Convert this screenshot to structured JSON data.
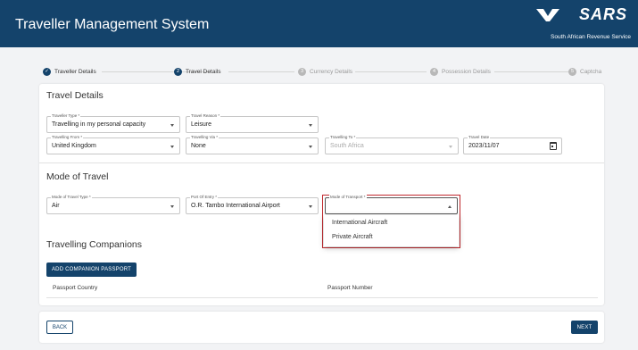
{
  "header": {
    "title": "Traveller Management System",
    "brand_logo": "SARS",
    "brand_subtitle": "South African Revenue Service",
    "bg_color": "#14436b"
  },
  "stepper": [
    {
      "number": "✓",
      "label": "Traveller Details",
      "state": "done"
    },
    {
      "number": "2",
      "label": "Travel Details",
      "state": "active"
    },
    {
      "number": "3",
      "label": "Currency Details",
      "state": "inactive"
    },
    {
      "number": "4",
      "label": "Possession Details",
      "state": "inactive"
    },
    {
      "number": "5",
      "label": "Captcha",
      "state": "inactive"
    }
  ],
  "travel_details": {
    "title": "Travel Details",
    "traveller_type": {
      "label": "Traveller Type *",
      "value": "Travelling in my personal capacity"
    },
    "travel_reason": {
      "label": "Travel Reason *",
      "value": "Leisure"
    },
    "travelling_from": {
      "label": "Travelling From *",
      "value": "United Kingdom"
    },
    "travelling_via": {
      "label": "Travelling Via *",
      "value": "None"
    },
    "travelling_to": {
      "label": "Travelling To *",
      "value": "South Africa"
    },
    "travel_date": {
      "label": "Travel Date",
      "value": "2023/11/07"
    }
  },
  "mode_of_travel": {
    "title": "Mode of Travel",
    "mode_type": {
      "label": "Mode of Travel Type *",
      "value": "Air"
    },
    "port_of_entry": {
      "label": "Port Of Entry *",
      "value": "O.R. Tambo International Airport"
    },
    "mode_of_transport": {
      "label": "Mode of Transport *",
      "value": ""
    },
    "transport_options": [
      "International Aircraft",
      "Private Aircraft"
    ],
    "highlight_color": "#c0282d"
  },
  "companions": {
    "title": "Travelling Companions",
    "add_button": "ADD COMPANION PASSPORT",
    "columns": [
      "Passport Country",
      "Passport Number"
    ]
  },
  "footer": {
    "back_label": "BACK",
    "next_label": "NEXT"
  }
}
